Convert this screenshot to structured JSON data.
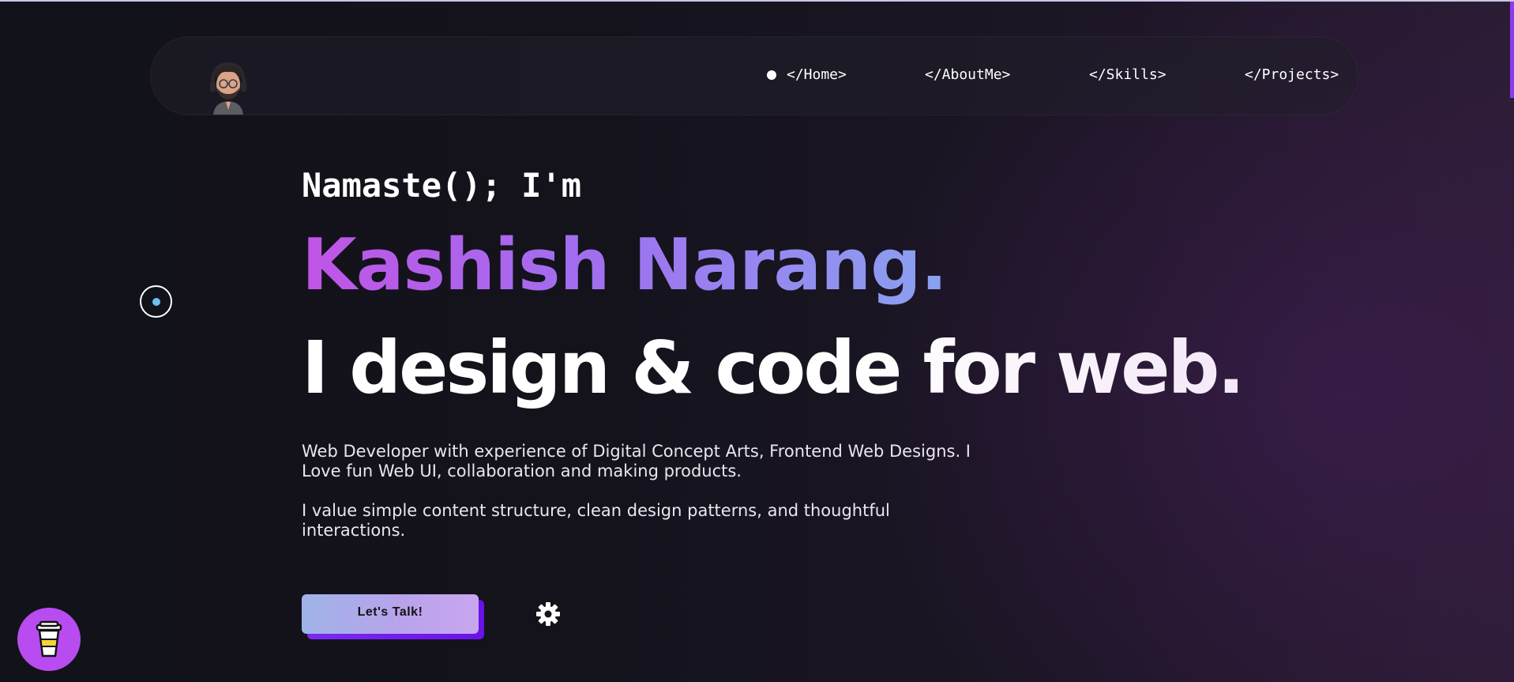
{
  "nav": {
    "links": [
      {
        "label": "</Home>",
        "active": true
      },
      {
        "label": "</AboutMe>"
      },
      {
        "label": "</Skills>"
      },
      {
        "label": "</Projects>"
      }
    ]
  },
  "hero": {
    "greeting": "Namaste(); I'm",
    "name": "Kashish Narang.",
    "tagline": "I design & code for web.",
    "paragraph1": "Web Developer with experience of Digital Concept Arts, Frontend Web Designs. I Love fun Web UI, collaboration and making products.",
    "paragraph2": "I value simple content structure, clean design patterns, and thoughtful interactions.",
    "cta_label": "Let's Talk!"
  },
  "icons": {
    "avatar": "avatar-icon",
    "settings": "gear-icon",
    "coffee": "coffee-cup-icon",
    "cursor": "cursor-ring-icon"
  },
  "colors": {
    "background": "#13121b",
    "name_gradient_start": "#c154e6",
    "name_gradient_end": "#8aa2f0",
    "accent_purple": "#8a3cf0",
    "coffee_button": "#b84cf0",
    "cursor_dot": "#6cc0f2"
  }
}
